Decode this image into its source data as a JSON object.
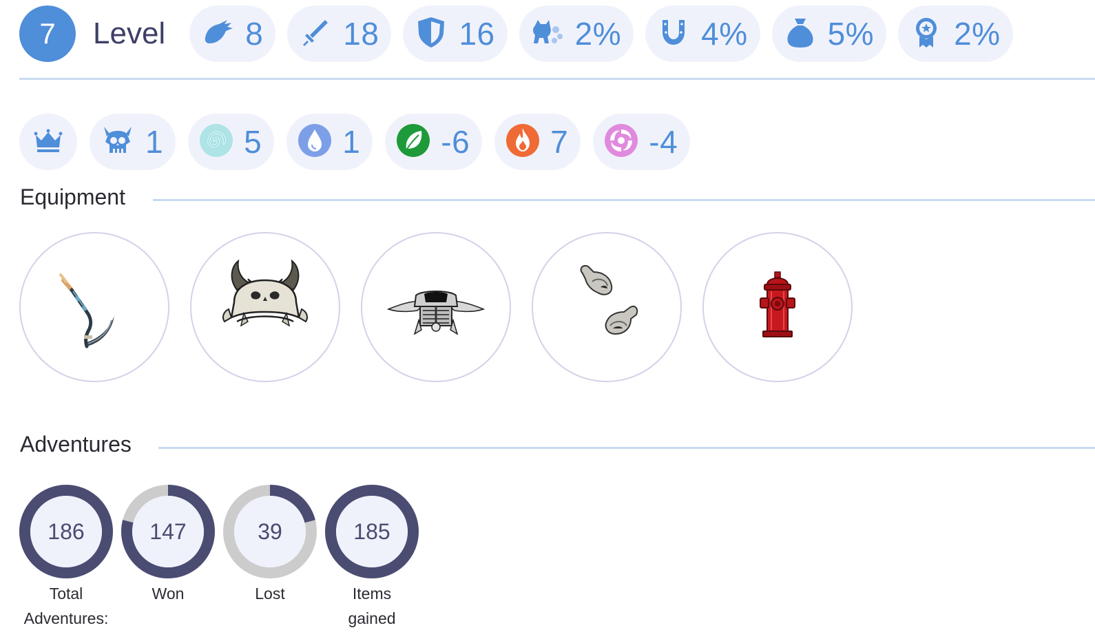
{
  "level": {
    "value": "7",
    "label": "Level"
  },
  "stats": [
    {
      "icon": "claw-icon",
      "value": "8"
    },
    {
      "icon": "sword-icon",
      "value": "18"
    },
    {
      "icon": "shield-icon",
      "value": "16"
    },
    {
      "icon": "pet-dust-icon",
      "value": "2%"
    },
    {
      "icon": "horseshoe-icon",
      "value": "4%"
    },
    {
      "icon": "money-bag-icon",
      "value": "5%"
    },
    {
      "icon": "award-ribbon-icon",
      "value": "2%"
    }
  ],
  "elements": [
    {
      "icon": "crown-icon",
      "value": ""
    },
    {
      "icon": "horned-skull-icon",
      "value": "1"
    },
    {
      "icon": "air-swirl-icon",
      "value": "5"
    },
    {
      "icon": "water-drop-icon",
      "value": "1"
    },
    {
      "icon": "leaf-icon",
      "value": "-6"
    },
    {
      "icon": "fire-icon",
      "value": "7"
    },
    {
      "icon": "arcane-spiral-icon",
      "value": "-4"
    }
  ],
  "equipment": {
    "title": "Equipment",
    "items": [
      {
        "icon": "scythe-weapon-icon"
      },
      {
        "icon": "horned-skull-helmet-icon"
      },
      {
        "icon": "bone-armor-icon"
      },
      {
        "icon": "bone-gloves-icon"
      },
      {
        "icon": "fire-hydrant-icon"
      }
    ]
  },
  "adventures": {
    "title": "Adventures",
    "items": [
      {
        "value": "186",
        "label_lines": [
          "Total",
          "Adventures:"
        ],
        "fill": 1.0
      },
      {
        "value": "147",
        "label_lines": [
          "Won"
        ],
        "fill": 0.79
      },
      {
        "value": "39",
        "label_lines": [
          "Lost"
        ],
        "fill": 0.21
      },
      {
        "value": "185",
        "label_lines": [
          "Items",
          "gained"
        ],
        "fill": 1.0
      }
    ]
  },
  "colors": {
    "accent": "#4f8ed9",
    "pill_bg": "#f0f2fb",
    "ring_fill": "#4b4c72",
    "ring_track": "#cccccc",
    "ring_inner": "#f0f2fb"
  }
}
